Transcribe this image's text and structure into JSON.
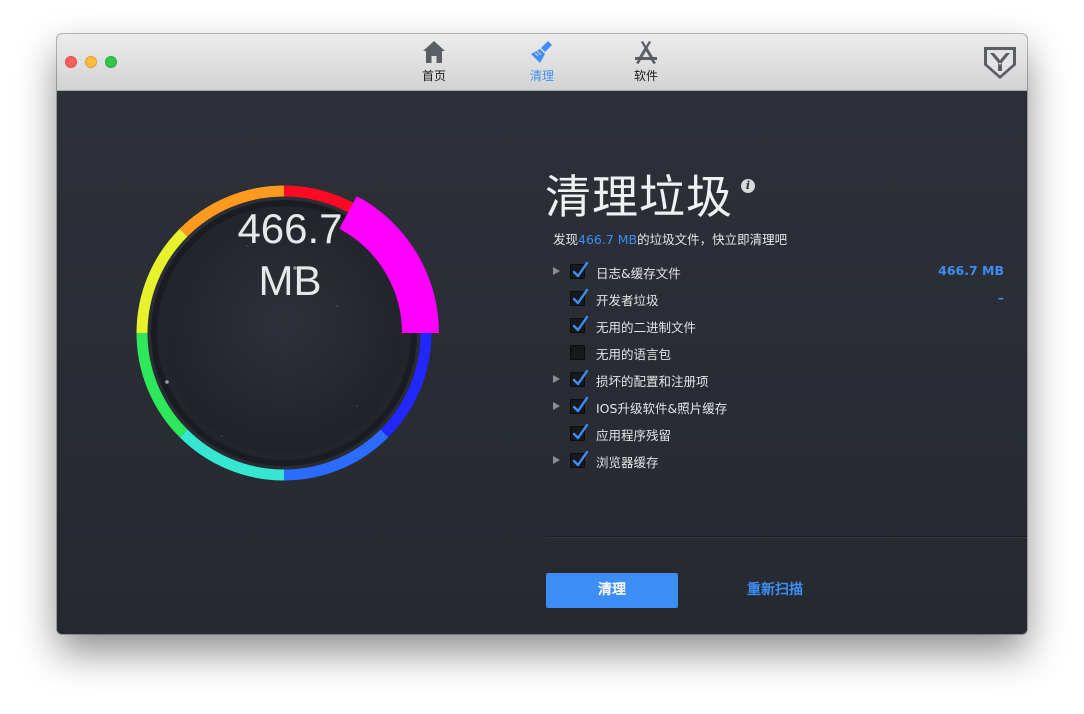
{
  "toolbar": {
    "tabs": [
      {
        "label": "首页",
        "icon": "home-icon"
      },
      {
        "label": "清理",
        "icon": "broom-icon"
      },
      {
        "label": "软件",
        "icon": "app-store-icon"
      }
    ],
    "active_tab": 1,
    "shield_icon": "shield-logo-icon"
  },
  "gauge": {
    "value_line1": "466.7",
    "value_line2": "MB"
  },
  "panel": {
    "title": "清理垃圾",
    "info_icon": "i",
    "summary_prefix": "发现",
    "summary_highlight": "466.7 MB",
    "summary_suffix": "的垃圾文件，快立即清理吧"
  },
  "items": [
    {
      "label": "日志&缓存文件",
      "checked": true,
      "expandable": true,
      "size": "466.7 MB"
    },
    {
      "label": "开发者垃圾",
      "checked": true,
      "expandable": false,
      "size": "–"
    },
    {
      "label": "无用的二进制文件",
      "checked": true,
      "expandable": false,
      "size": ""
    },
    {
      "label": "无用的语言包",
      "checked": false,
      "expandable": false,
      "size": ""
    },
    {
      "label": "损坏的配置和注册项",
      "checked": true,
      "expandable": true,
      "size": ""
    },
    {
      "label": "IOS升级软件&照片缓存",
      "checked": true,
      "expandable": true,
      "size": ""
    },
    {
      "label": "应用程序残留",
      "checked": true,
      "expandable": false,
      "size": ""
    },
    {
      "label": "浏览器缓存",
      "checked": true,
      "expandable": true,
      "size": ""
    }
  ],
  "actions": {
    "clean_label": "清理",
    "rescan_label": "重新扫描"
  },
  "colors": {
    "accent": "#3d8ef4",
    "background": "#2c2f36",
    "highlight_segment": "#ff00ff"
  }
}
